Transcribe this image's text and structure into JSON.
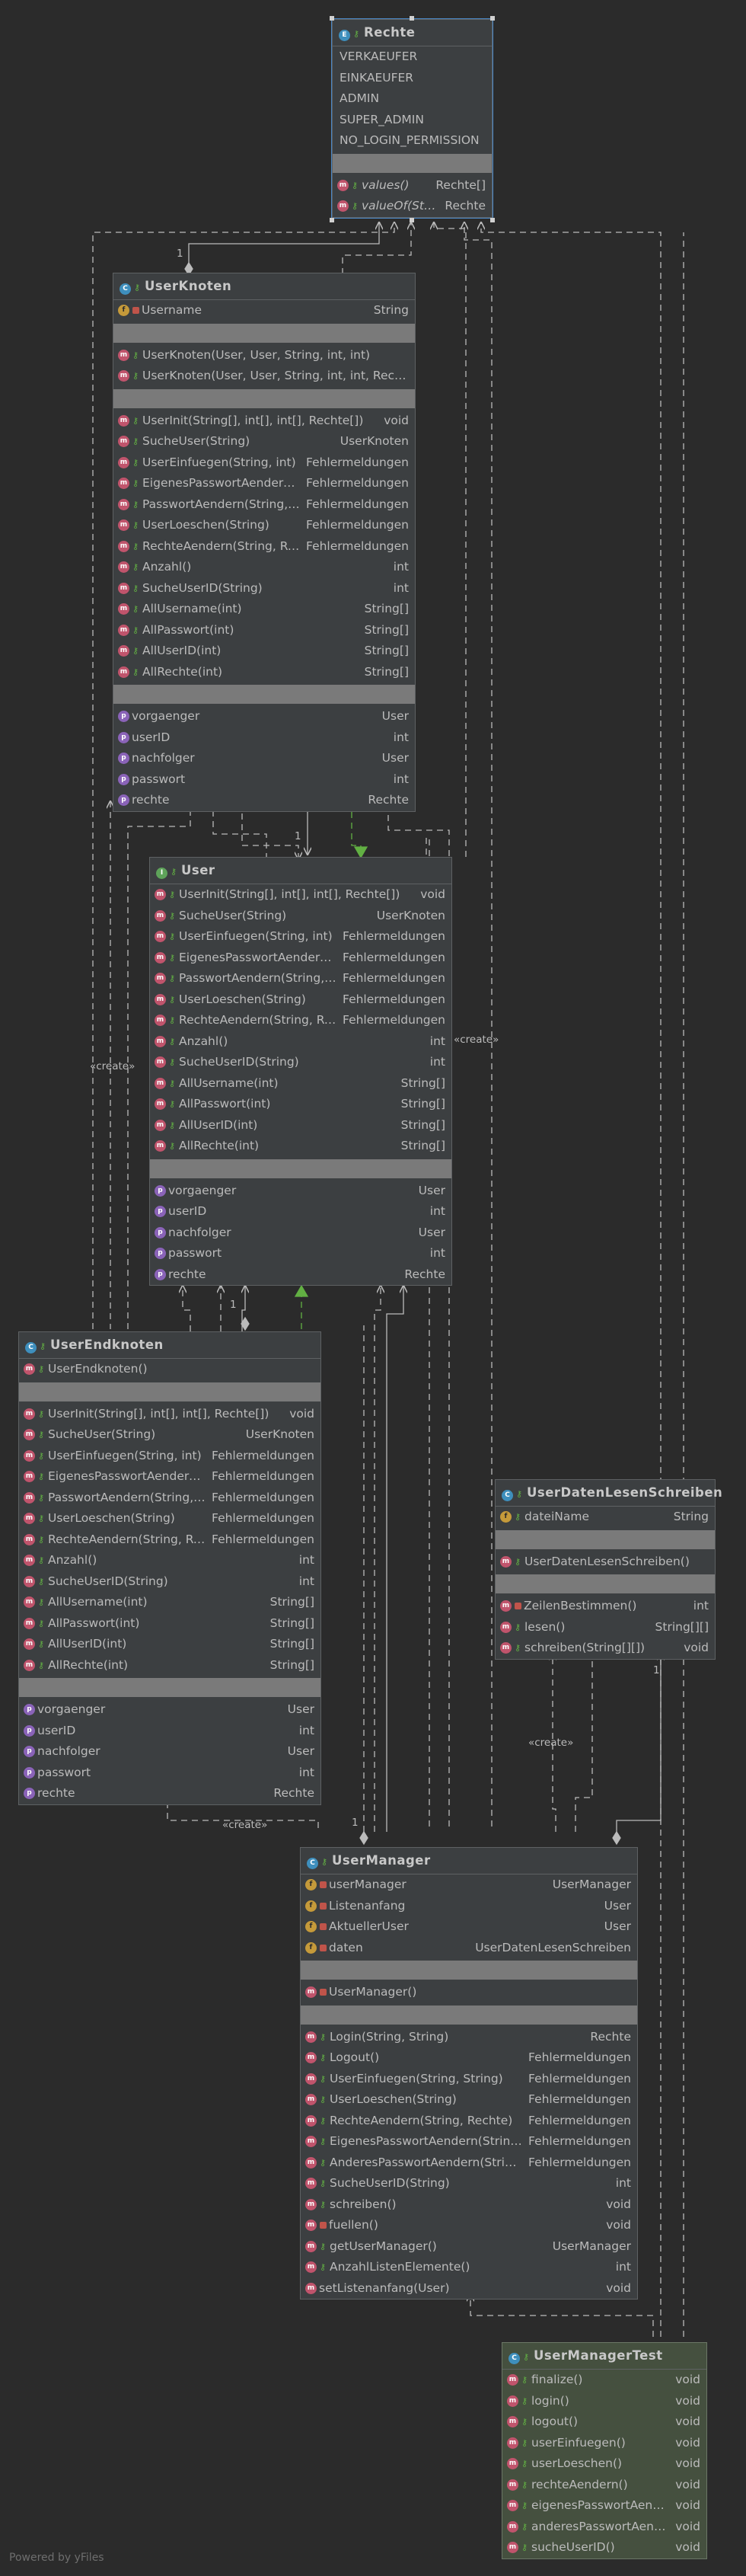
{
  "footer": "Powered by yFiles",
  "create_label": "«create»",
  "multiplicity": "1",
  "classes": {
    "rechte": {
      "title": "Rechte",
      "kind": "enum",
      "section1": [
        {
          "label": "VERKAEUFER"
        },
        {
          "label": "EINKAEUFER"
        },
        {
          "label": "ADMIN"
        },
        {
          "label": "SUPER_ADMIN"
        },
        {
          "label": "NO_LOGIN_PERMISSION"
        }
      ],
      "section2": [
        {
          "label": "values()",
          "type": "Rechte[]"
        },
        {
          "label": "valueOf(String)",
          "type": "Rechte"
        }
      ]
    },
    "userknoten": {
      "title": "UserKnoten",
      "fields": [
        {
          "label": "Username",
          "type": "String"
        }
      ],
      "constructors": [
        {
          "label": "UserKnoten(User, User, String, int, int)"
        },
        {
          "label": "UserKnoten(User, User, String, int, int, Rechte)"
        }
      ],
      "methods": [
        {
          "label": "UserInit(String[], int[], int[], Rechte[])",
          "type": "void"
        },
        {
          "label": "SucheUser(String)",
          "type": "UserKnoten"
        },
        {
          "label": "UserEinfuegen(String, int)",
          "type": "Fehlermeldungen"
        },
        {
          "label": "EigenesPasswortAendern(int, int)",
          "type": "Fehlermeldungen"
        },
        {
          "label": "PasswortAendern(String, int)",
          "type": "Fehlermeldungen"
        },
        {
          "label": "UserLoeschen(String)",
          "type": "Fehlermeldungen"
        },
        {
          "label": "RechteAendern(String, Rechte)",
          "type": "Fehlermeldungen"
        },
        {
          "label": "Anzahl()",
          "type": "int"
        },
        {
          "label": "SucheUserID(String)",
          "type": "int"
        },
        {
          "label": "AllUsername(int)",
          "type": "String[]"
        },
        {
          "label": "AllPasswort(int)",
          "type": "String[]"
        },
        {
          "label": "AllUserID(int)",
          "type": "String[]"
        },
        {
          "label": "AllRechte(int)",
          "type": "String[]"
        }
      ],
      "props": [
        {
          "label": "vorgaenger",
          "type": "User"
        },
        {
          "label": "userID",
          "type": "int"
        },
        {
          "label": "nachfolger",
          "type": "User"
        },
        {
          "label": "passwort",
          "type": "int"
        },
        {
          "label": "rechte",
          "type": "Rechte"
        }
      ]
    },
    "user": {
      "title": "User",
      "methods": [
        {
          "label": "UserInit(String[], int[], int[], Rechte[])",
          "type": "void"
        },
        {
          "label": "SucheUser(String)",
          "type": "UserKnoten"
        },
        {
          "label": "UserEinfuegen(String, int)",
          "type": "Fehlermeldungen"
        },
        {
          "label": "EigenesPasswortAendern(int, int)",
          "type": "Fehlermeldungen"
        },
        {
          "label": "PasswortAendern(String, int)",
          "type": "Fehlermeldungen"
        },
        {
          "label": "UserLoeschen(String)",
          "type": "Fehlermeldungen"
        },
        {
          "label": "RechteAendern(String, Rechte)",
          "type": "Fehlermeldungen"
        },
        {
          "label": "Anzahl()",
          "type": "int"
        },
        {
          "label": "SucheUserID(String)",
          "type": "int"
        },
        {
          "label": "AllUsername(int)",
          "type": "String[]"
        },
        {
          "label": "AllPasswort(int)",
          "type": "String[]"
        },
        {
          "label": "AllUserID(int)",
          "type": "String[]"
        },
        {
          "label": "AllRechte(int)",
          "type": "String[]"
        }
      ],
      "props": [
        {
          "label": "vorgaenger",
          "type": "User"
        },
        {
          "label": "userID",
          "type": "int"
        },
        {
          "label": "nachfolger",
          "type": "User"
        },
        {
          "label": "passwort",
          "type": "int"
        },
        {
          "label": "rechte",
          "type": "Rechte"
        }
      ]
    },
    "userendknoten": {
      "title": "UserEndknoten",
      "constructors": [
        {
          "label": "UserEndknoten()"
        }
      ],
      "methods": [
        {
          "label": "UserInit(String[], int[], int[], Rechte[])",
          "type": "void"
        },
        {
          "label": "SucheUser(String)",
          "type": "UserKnoten"
        },
        {
          "label": "UserEinfuegen(String, int)",
          "type": "Fehlermeldungen"
        },
        {
          "label": "EigenesPasswortAendern(int, int)",
          "type": "Fehlermeldungen"
        },
        {
          "label": "PasswortAendern(String, int)",
          "type": "Fehlermeldungen"
        },
        {
          "label": "UserLoeschen(String)",
          "type": "Fehlermeldungen"
        },
        {
          "label": "RechteAendern(String, Rechte)",
          "type": "Fehlermeldungen"
        },
        {
          "label": "Anzahl()",
          "type": "int"
        },
        {
          "label": "SucheUserID(String)",
          "type": "int"
        },
        {
          "label": "AllUsername(int)",
          "type": "String[]"
        },
        {
          "label": "AllPasswort(int)",
          "type": "String[]"
        },
        {
          "label": "AllUserID(int)",
          "type": "String[]"
        },
        {
          "label": "AllRechte(int)",
          "type": "String[]"
        }
      ],
      "props": [
        {
          "label": "vorgaenger",
          "type": "User"
        },
        {
          "label": "userID",
          "type": "int"
        },
        {
          "label": "nachfolger",
          "type": "User"
        },
        {
          "label": "passwort",
          "type": "int"
        },
        {
          "label": "rechte",
          "type": "Rechte"
        }
      ]
    },
    "userdaten": {
      "title": "UserDatenLesenSchreiben",
      "fields": [
        {
          "label": "dateiName",
          "type": "String"
        }
      ],
      "constructors": [
        {
          "label": "UserDatenLesenSchreiben()"
        }
      ],
      "methods": [
        {
          "label": "ZeilenBestimmen()",
          "type": "int"
        },
        {
          "label": "lesen()",
          "type": "String[][]"
        },
        {
          "label": "schreiben(String[][])",
          "type": "void"
        }
      ]
    },
    "usermanager": {
      "title": "UserManager",
      "fields": [
        {
          "label": "userManager",
          "type": "UserManager"
        },
        {
          "label": "Listenanfang",
          "type": "User"
        },
        {
          "label": "AktuellerUser",
          "type": "User"
        },
        {
          "label": "daten",
          "type": "UserDatenLesenSchreiben"
        }
      ],
      "constructors": [
        {
          "label": "UserManager()"
        }
      ],
      "methods": [
        {
          "label": "Login(String, String)",
          "type": "Rechte"
        },
        {
          "label": "Logout()",
          "type": "Fehlermeldungen"
        },
        {
          "label": "UserEinfuegen(String, String)",
          "type": "Fehlermeldungen"
        },
        {
          "label": "UserLoeschen(String)",
          "type": "Fehlermeldungen"
        },
        {
          "label": "RechteAendern(String, Rechte)",
          "type": "Fehlermeldungen"
        },
        {
          "label": "EigenesPasswortAendern(String, String)",
          "type": "Fehlermeldungen"
        },
        {
          "label": "AnderesPasswortAendern(String, String)",
          "type": "Fehlermeldungen"
        },
        {
          "label": "SucheUserID(String)",
          "type": "int"
        },
        {
          "label": "schreiben()",
          "type": "void"
        },
        {
          "label": "fuellen()",
          "type": "void"
        },
        {
          "label": "getUserManager()",
          "type": "UserManager"
        },
        {
          "label": "AnzahlListenElemente()",
          "type": "int"
        },
        {
          "label": "setListenanfang(User)",
          "type": "void"
        }
      ]
    },
    "usermanagertest": {
      "title": "UserManagerTest",
      "methods": [
        {
          "label": "finalize()",
          "type": "void"
        },
        {
          "label": "login()",
          "type": "void"
        },
        {
          "label": "logout()",
          "type": "void"
        },
        {
          "label": "userEinfuegen()",
          "type": "void"
        },
        {
          "label": "userLoeschen()",
          "type": "void"
        },
        {
          "label": "rechteAendern()",
          "type": "void"
        },
        {
          "label": "eigenesPasswortAendern()",
          "type": "void"
        },
        {
          "label": "anderesPasswortAendern()",
          "type": "void"
        },
        {
          "label": "sucheUserID()",
          "type": "void"
        }
      ]
    }
  }
}
